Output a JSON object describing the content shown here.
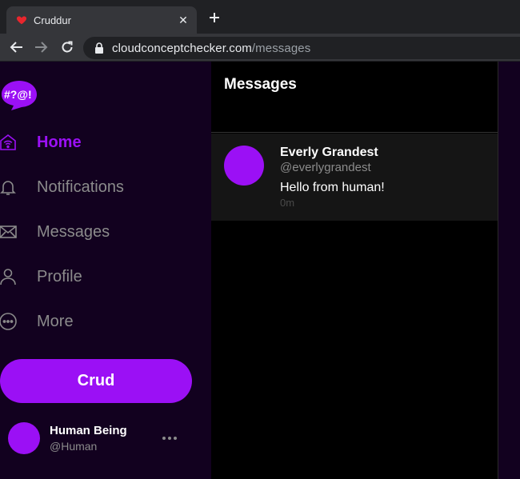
{
  "browser": {
    "tab_title": "Cruddur",
    "url_host": "cloudconceptchecker.com",
    "url_path": "/messages"
  },
  "app": {
    "logo_text": "#?@!",
    "nav": [
      {
        "label": "Home",
        "icon": "home-icon",
        "active": true
      },
      {
        "label": "Notifications",
        "icon": "bell-icon",
        "active": false
      },
      {
        "label": "Messages",
        "icon": "envelope-icon",
        "active": false
      },
      {
        "label": "Profile",
        "icon": "person-icon",
        "active": false
      },
      {
        "label": "More",
        "icon": "more-circle-icon",
        "active": false
      }
    ],
    "crud_button": "Crud",
    "user": {
      "name": "Human Being",
      "handle": "@Human"
    },
    "colors": {
      "accent": "#9b10f5",
      "sidebar_bg": "#12011f",
      "muted": "#8b8b8b"
    }
  },
  "main": {
    "title": "Messages",
    "messages": [
      {
        "sender_name": "Everly Grandest",
        "sender_handle": "@everlygrandest",
        "body": "Hello from human!",
        "time": "0m"
      }
    ]
  }
}
